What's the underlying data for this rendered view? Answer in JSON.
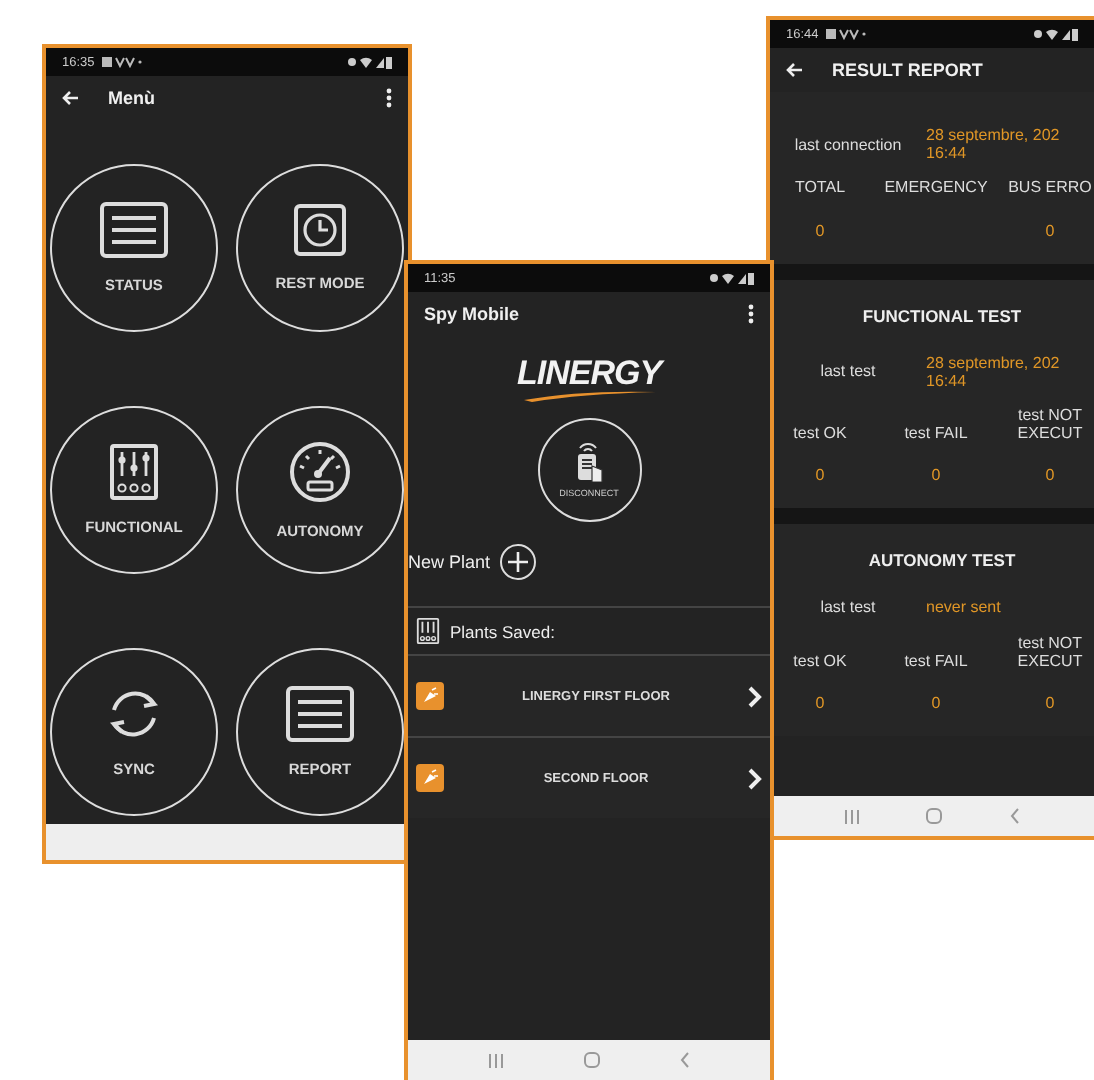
{
  "menu_screen": {
    "status_time": "16:35",
    "title": "Menù",
    "items": [
      {
        "label": "STATUS",
        "kind": "list"
      },
      {
        "label": "REST MODE",
        "kind": "clock"
      },
      {
        "label": "FUNCTIONAL",
        "kind": "sliders"
      },
      {
        "label": "AUTONOMY",
        "kind": "gauge"
      },
      {
        "label": "SYNC",
        "kind": "sync"
      },
      {
        "label": "REPORT",
        "kind": "list"
      }
    ]
  },
  "plants_screen": {
    "status_time": "11:35",
    "title": "Spy Mobile",
    "logo": "LINERGY",
    "connect_button": "DISCONNECT",
    "new_plant": "New Plant",
    "saved_heading": "Plants Saved:",
    "plants": [
      {
        "name": "LINERGY FIRST FLOOR"
      },
      {
        "name": "SECOND FLOOR"
      }
    ]
  },
  "report_screen": {
    "status_time": "16:44",
    "title": "RESULT REPORT",
    "sections": [
      {
        "date_label": "last connection",
        "date_lines": [
          "28 septembre, 202",
          "16:44"
        ],
        "columns": [
          {
            "label_lines": [
              "TOTAL"
            ],
            "value": "0"
          },
          {
            "label_lines": [
              "EMERGENCY"
            ]
          },
          {
            "label_lines": [
              "BUS ERRO"
            ],
            "value": "0"
          }
        ]
      },
      {
        "heading": "FUNCTIONAL TEST",
        "date_label": "last test",
        "date_lines": [
          "28 septembre, 202",
          "16:44"
        ],
        "columns": [
          {
            "label_lines": [
              "test OK"
            ],
            "value": "0"
          },
          {
            "label_lines": [
              "test FAIL"
            ],
            "value": "0"
          },
          {
            "label_lines": [
              "test NOT",
              "EXECUT"
            ],
            "value": "0"
          }
        ]
      },
      {
        "heading": "AUTONOMY TEST",
        "date_label": "last test",
        "date_lines": [
          "never sent"
        ],
        "columns": [
          {
            "label_lines": [
              "test OK"
            ],
            "value": "0"
          },
          {
            "label_lines": [
              "test FAIL"
            ],
            "value": "0"
          },
          {
            "label_lines": [
              "test NOT",
              "EXECUT"
            ],
            "value": "0"
          }
        ]
      }
    ]
  }
}
